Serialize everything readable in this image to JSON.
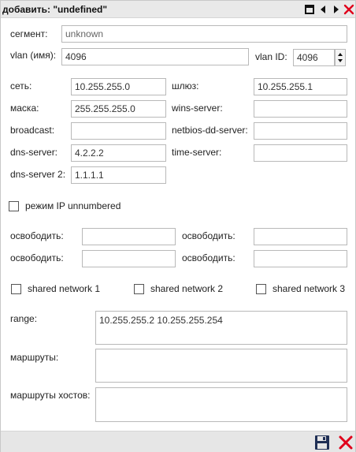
{
  "dialog": {
    "title": "добавить: \"undefined\""
  },
  "fields": {
    "segment_label": "сегмент:",
    "segment_value": "unknown",
    "vlan_name_label": "vlan (имя):",
    "vlan_name_value": "4096",
    "vlan_id_label": "vlan ID:",
    "vlan_id_value": "4096",
    "network_label": "сеть:",
    "network_value": "10.255.255.0",
    "gateway_label": "шлюз:",
    "gateway_value": "10.255.255.1",
    "mask_label": "маска:",
    "mask_value": "255.255.255.0",
    "wins_label": "wins-server:",
    "wins_value": "",
    "broadcast_label": "broadcast:",
    "broadcast_value": "",
    "netbios_label": "netbios-dd-server:",
    "netbios_value": "",
    "dns_label": "dns-server:",
    "dns_value": "4.2.2.2",
    "time_label": "time-server:",
    "time_value": "",
    "dns2_label": "dns-server 2:",
    "dns2_value": "1.1.1.1"
  },
  "unnumbered": {
    "label": "режим IP unnumbered",
    "checked": false
  },
  "release": {
    "label": "освободить:",
    "values": [
      "",
      "",
      "",
      ""
    ]
  },
  "shared_networks": [
    {
      "label": "shared network 1",
      "checked": false
    },
    {
      "label": "shared network 2",
      "checked": false
    },
    {
      "label": "shared network 3",
      "checked": false
    }
  ],
  "range": {
    "label": "range:",
    "value": "10.255.255.2 10.255.255.254"
  },
  "routes": {
    "label": "маршруты:",
    "value": ""
  },
  "host_routes": {
    "label": "маршруты хостов:",
    "value": ""
  },
  "colors": {
    "titlebar": "#e9e9e9",
    "close_red": "#e0001b",
    "save_blue": "#1f2f55"
  },
  "icons": {
    "maximize": "maximize-icon",
    "prev": "arrow-left-icon",
    "next": "arrow-right-icon",
    "close": "close-icon",
    "save": "floppy-save-icon",
    "cancel": "cancel-icon"
  }
}
